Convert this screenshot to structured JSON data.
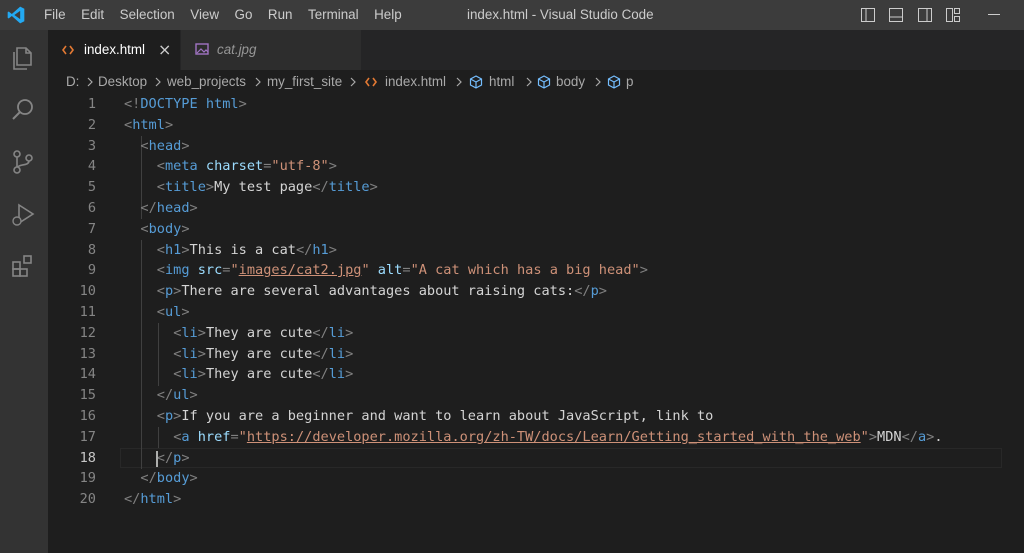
{
  "menu": [
    "File",
    "Edit",
    "Selection",
    "View",
    "Go",
    "Run",
    "Terminal",
    "Help"
  ],
  "window_title": "index.html - Visual Studio Code",
  "tabs": [
    {
      "label": "index.html",
      "close": "×"
    },
    {
      "label": "cat.jpg"
    }
  ],
  "breadcrumb": [
    "D:",
    "Desktop",
    "web_projects",
    "my_first_site",
    "index.html",
    "html",
    "body",
    "p"
  ],
  "code": {
    "line_numbers": [
      "1",
      "2",
      "3",
      "4",
      "5",
      "6",
      "7",
      "8",
      "9",
      "10",
      "11",
      "12",
      "13",
      "14",
      "15",
      "16",
      "17",
      "18",
      "19",
      "20"
    ],
    "current_line": "18",
    "lines": [
      [
        "<!",
        "DOCTYPE",
        " html",
        ">"
      ],
      [
        "<",
        "html",
        ">"
      ],
      [
        "<",
        "head",
        ">"
      ],
      [
        "<",
        "meta",
        " charset",
        "=",
        "\"utf-8\"",
        ">"
      ],
      [
        "<",
        "title",
        ">",
        "My test page",
        "</",
        "title",
        ">"
      ],
      [
        "</",
        "head",
        ">"
      ],
      [
        "<",
        "body",
        ">"
      ],
      [
        "<",
        "h1",
        ">",
        "This is a cat",
        "</",
        "h1",
        ">"
      ],
      [
        "<",
        "img",
        " src",
        "=",
        "\"",
        "images/cat2.jpg",
        "\"",
        " alt",
        "=",
        "\"A cat which has a big head\"",
        ">"
      ],
      [
        "<",
        "p",
        ">",
        "There are several advantages about raising cats:",
        "</",
        "p",
        ">"
      ],
      [
        "<",
        "ul",
        ">"
      ],
      [
        "<",
        "li",
        ">",
        "They are cute",
        "</",
        "li",
        ">"
      ],
      [
        "<",
        "li",
        ">",
        "They are cute",
        "</",
        "li",
        ">"
      ],
      [
        "<",
        "li",
        ">",
        "They are cute",
        "</",
        "li",
        ">"
      ],
      [
        "</",
        "ul",
        ">"
      ],
      [
        "<",
        "p",
        ">",
        "If you are a beginner and want to learn about JavaScript, link to"
      ],
      [
        "<",
        "a",
        " href",
        "=",
        "\"",
        "https://developer.mozilla.org/zh-TW/docs/Learn/Getting_started_with_the_web",
        "\"",
        ">",
        "MDN",
        "</",
        "a",
        ">",
        "."
      ],
      [
        "</",
        "p",
        ">"
      ],
      [
        "</",
        "body",
        ">"
      ],
      [
        "</",
        "html",
        ">"
      ]
    ]
  },
  "colors": {
    "tag": "#569cd6",
    "bracket": "#808080",
    "attribute": "#9cdcfe",
    "string": "#ce9178",
    "text": "#d4d4d4",
    "html_icon": "#e37933",
    "image_icon": "#a074c4",
    "symbol_icon": "#75beff",
    "activity_bar": "#333333",
    "accent_logo": "#23a9f2"
  },
  "icons": [
    "vscode-logo",
    "explorer-icon",
    "search-icon",
    "source-control-icon",
    "run-debug-icon",
    "extensions-icon",
    "toggle-primary-sidebar-icon",
    "toggle-panel-icon",
    "toggle-secondary-sidebar-icon",
    "customize-layout-icon",
    "minimize-icon",
    "html-file-icon",
    "image-file-icon",
    "symbol-icon",
    "chevron-right-icon"
  ]
}
